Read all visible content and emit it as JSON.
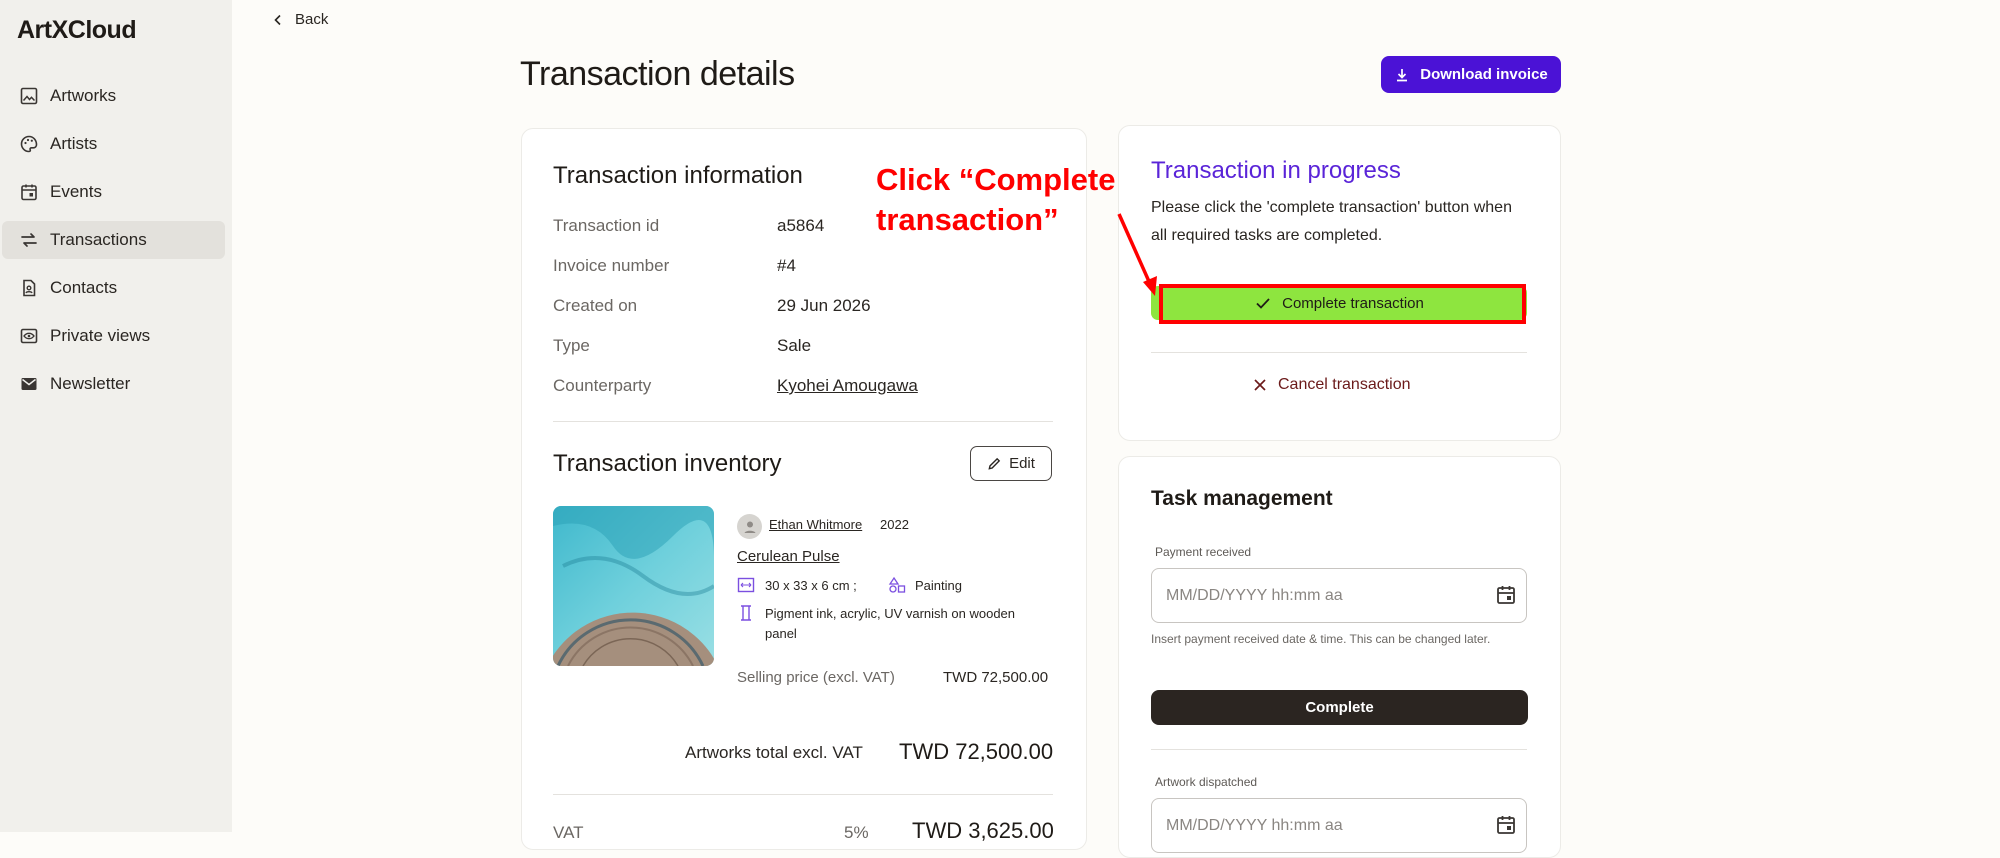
{
  "brand": {
    "logo_text": "ArtXCloud"
  },
  "sidebar": {
    "items": [
      {
        "label": "Artworks",
        "icon": "image-icon"
      },
      {
        "label": "Artists",
        "icon": "palette-icon"
      },
      {
        "label": "Events",
        "icon": "calendar-icon"
      },
      {
        "label": "Transactions",
        "icon": "swap-icon",
        "active": true
      },
      {
        "label": "Contacts",
        "icon": "contact-icon"
      },
      {
        "label": "Private views",
        "icon": "eye-icon"
      },
      {
        "label": "Newsletter",
        "icon": "mail-icon"
      }
    ]
  },
  "header": {
    "back_label": "Back",
    "title": "Transaction details",
    "download_label": "Download invoice"
  },
  "info": {
    "title": "Transaction information",
    "rows": [
      {
        "label": "Transaction id",
        "value": "a5864"
      },
      {
        "label": "Invoice number",
        "value": "#4"
      },
      {
        "label": "Created on",
        "value": "29 Jun 2026"
      },
      {
        "label": "Type",
        "value": "Sale"
      },
      {
        "label": "Counterparty",
        "value": "Kyohei Amougawa"
      }
    ]
  },
  "inventory": {
    "title": "Transaction inventory",
    "edit_label": "Edit",
    "item": {
      "artist": "Ethan Whitmore",
      "year": "2022",
      "title": "Cerulean Pulse",
      "dimensions": "30 x 33 x 6 cm ;",
      "medium_type": "Painting",
      "materials_line1": "Pigment ink, acrylic, UV varnish on wooden",
      "materials_line2": "panel",
      "price_label": "Selling price (excl. VAT)",
      "price_value": "TWD  72,500.00"
    },
    "total_label": "Artworks total excl. VAT",
    "total_value": "TWD 72,500.00",
    "vat_label": "VAT",
    "vat_pct": "5%",
    "vat_value": "TWD 3,625.00"
  },
  "progress": {
    "title": "Transaction in progress",
    "description": "Please click the 'complete transaction' button when all required tasks are completed.",
    "complete_label": "Complete transaction",
    "cancel_label": "Cancel transaction"
  },
  "tasks": {
    "title": "Task management",
    "payment_label": "Payment received",
    "payment_placeholder": "MM/DD/YYYY hh:mm aa",
    "payment_help": "Insert payment received date & time. This can be changed later.",
    "complete_label": "Complete",
    "dispatch_label": "Artwork dispatched",
    "dispatch_placeholder": "MM/DD/YYYY hh:mm aa"
  },
  "annotation": {
    "line1": "Click “Complete",
    "line2": "transaction”"
  },
  "colors": {
    "accent": "#4b12d6",
    "progress_title": "#5a24d8",
    "complete_button": "#8ee53f",
    "highlight": "#ff0000",
    "dark_button": "#2b2521"
  }
}
